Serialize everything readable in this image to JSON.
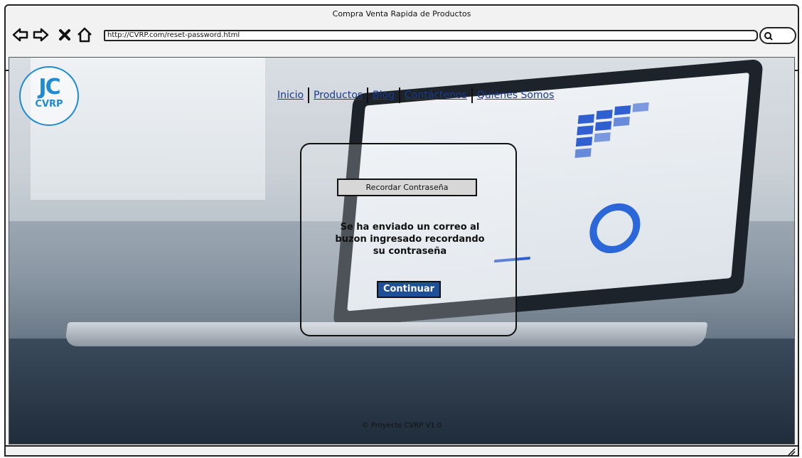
{
  "window": {
    "title": "Compra Venta Rapida de Productos"
  },
  "toolbar": {
    "url": "http://CVRP.com/reset-password.html",
    "icons": [
      "back-icon",
      "forward-icon",
      "close-icon",
      "home-icon",
      "search-icon"
    ]
  },
  "logo": {
    "mark": "JC",
    "text": "CVRP",
    "color": "#1e8bd3"
  },
  "nav": {
    "items": [
      {
        "label": "Inicio"
      },
      {
        "label": "Productos"
      },
      {
        "label": "Blog"
      },
      {
        "label": "Contáctenos"
      },
      {
        "label": "Quienes Somos"
      }
    ],
    "link_color": "#1a3a8f"
  },
  "dialog": {
    "header": "Recordar Contraseña",
    "message": "Se ha enviado un correo al buzon ingresado recordando su contraseña",
    "button_label": "Continuar",
    "button_color": "#1f4f96"
  },
  "footer": {
    "text": "© Proyecto CVRP V1.0"
  }
}
